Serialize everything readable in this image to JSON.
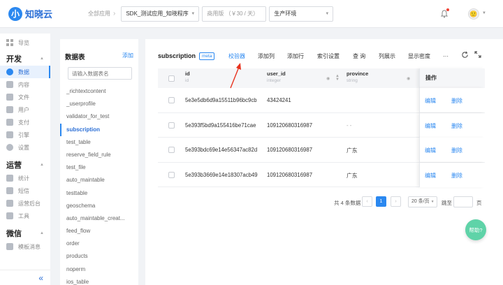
{
  "topbar": {
    "logo_text": "知晓云",
    "logo_mark": "小",
    "breadcrumb_all": "全部应用",
    "breadcrumb_sep": "›",
    "app_select": "SDK_测试应用_知晓程序",
    "plan_select": "商用版 （￥30 / 天）",
    "env_select": "生产环境",
    "avatar": "🙂"
  },
  "nav": {
    "overview": "导览",
    "groups": {
      "dev": "开发",
      "ops": "运营",
      "wechat": "微信"
    },
    "dev_items": [
      {
        "label": "数据",
        "icon": "pie-chart-icon"
      },
      {
        "label": "内容",
        "icon": "content-icon"
      },
      {
        "label": "文件",
        "icon": "folder-icon"
      },
      {
        "label": "用户",
        "icon": "user-icon"
      },
      {
        "label": "支付",
        "icon": "payment-icon"
      },
      {
        "label": "引擎",
        "icon": "engine-icon"
      },
      {
        "label": "设置",
        "icon": "gear-icon"
      }
    ],
    "ops_items": [
      {
        "label": "统计",
        "icon": "stats-icon"
      },
      {
        "label": "短信",
        "icon": "sms-icon"
      },
      {
        "label": "运营后台",
        "icon": "dashboard-icon"
      },
      {
        "label": "工具",
        "icon": "tool-icon"
      }
    ],
    "wechat_items": [
      {
        "label": "模板消息",
        "icon": "message-icon"
      }
    ],
    "collapse": "«"
  },
  "tablelist": {
    "title": "数据表",
    "add": "添加",
    "search_placeholder": "请输入数据表名",
    "items": [
      "_richtextcontent",
      "_userprofile",
      "validator_for_test",
      "subscription",
      "test_table",
      "reserve_field_rule",
      "test_file",
      "auto_maintable",
      "testtable",
      "geoschema",
      "auto_maintable_creat...",
      "feed_flow",
      "order",
      "products",
      "noperm",
      "ios_table"
    ],
    "active_index": 3
  },
  "main": {
    "table_name": "subscription",
    "meta_badge": "meta",
    "toolbar": {
      "validator": "校验器",
      "add_column": "添加列",
      "add_row": "添加行",
      "index_settings": "索引设置",
      "query": "查 询",
      "column_display": "列展示",
      "display_density": "显示密度",
      "more": "···",
      "refresh_icon": "refresh-icon",
      "expand_icon": "expand-icon"
    },
    "columns": [
      {
        "name": "id",
        "type": "id"
      },
      {
        "name": "user_id",
        "type": "integer"
      },
      {
        "name": "province",
        "type": "string"
      }
    ],
    "ops_header": "操作",
    "rows": [
      {
        "id": "5e3e5db6d9a15511b96bc9cb",
        "user_id": "43424241",
        "province": ""
      },
      {
        "id": "5e393f5bd9a155416be71cae",
        "user_id": "109120680316987",
        "province": "- -"
      },
      {
        "id": "5e393bdc69e14e56347ac82d",
        "user_id": "109120680316987",
        "province": "广东"
      },
      {
        "id": "5e393b3669e14e18307acb49",
        "user_id": "109120680316987",
        "province": "广东"
      }
    ],
    "edit": "编辑",
    "delete": "删除"
  },
  "pagination": {
    "total": "共 4 条数据",
    "prev": "‹",
    "current": "1",
    "next": "›",
    "page_size": "20 条/页",
    "jump_label": "跳至",
    "unit": "页"
  },
  "help": "帮助?",
  "colors": {
    "accent": "#2b88f0",
    "annotation_arrow": "#e8321e",
    "help_button": "#5fd3a8"
  }
}
